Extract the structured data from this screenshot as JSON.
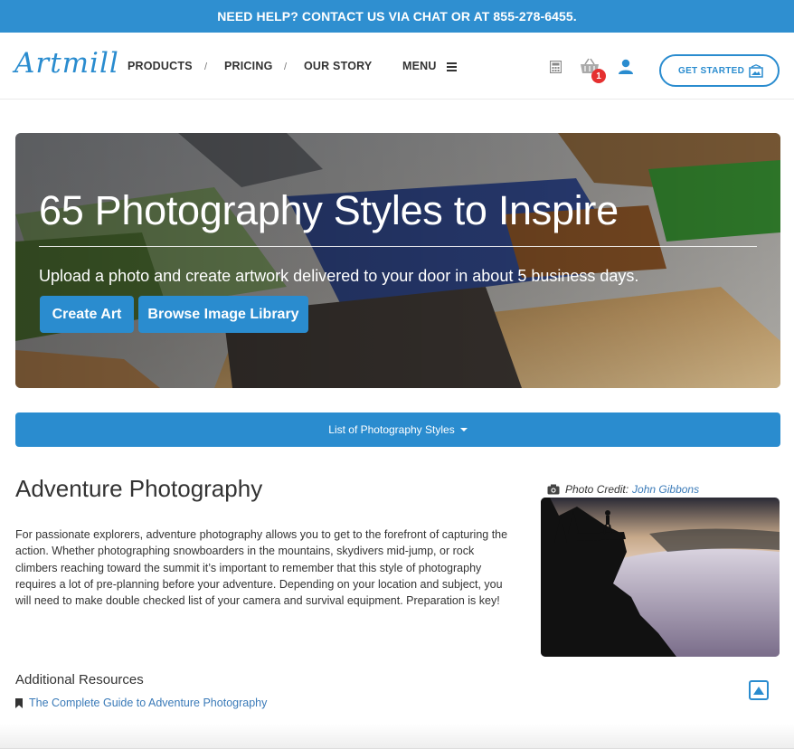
{
  "topbar": {
    "text": "NEED HELP? CONTACT US VIA CHAT OR AT 855-278-6455."
  },
  "header": {
    "logo": "Artmill",
    "nav": [
      {
        "label": "PRODUCTS"
      },
      {
        "label": "PRICING"
      },
      {
        "label": "OUR STORY"
      },
      {
        "label": "MENU"
      }
    ],
    "separator": "/",
    "cart_count": "1",
    "icons": [
      "calculator-icon",
      "basket-icon",
      "user-icon",
      "frame-icon"
    ],
    "get_started_label": "GET STARTED",
    "accent_color": "#2a8ccf"
  },
  "hero": {
    "title": "65 Photography Styles to Inspire",
    "subtitle": "Upload a photo and create artwork delivered to your door in about 5 business days.",
    "buttons": [
      {
        "label": "Create Art"
      },
      {
        "label": "Browse Image Library"
      }
    ]
  },
  "styles_dropdown": {
    "label": "List of Photography Styles"
  },
  "section": {
    "title": "Adventure Photography",
    "body": "For passionate explorers, adventure photography allows you to get to the forefront of capturing the action. Whether photographing snowboarders in the mountains, skydivers mid-jump, or rock climbers reaching toward the summit it’s important to remember that this style of photography requires a lot of pre-planning before your adventure. Depending on your location and subject, you will need to make double checked list of your camera and survival equipment. Preparation is key!",
    "photo_credit_label": "Photo Credit:",
    "photo_credit_name": "John Gibbons"
  },
  "resources": {
    "title": "Additional Resources",
    "links": [
      {
        "label": "The Complete Guide to Adventure Photography"
      }
    ]
  }
}
